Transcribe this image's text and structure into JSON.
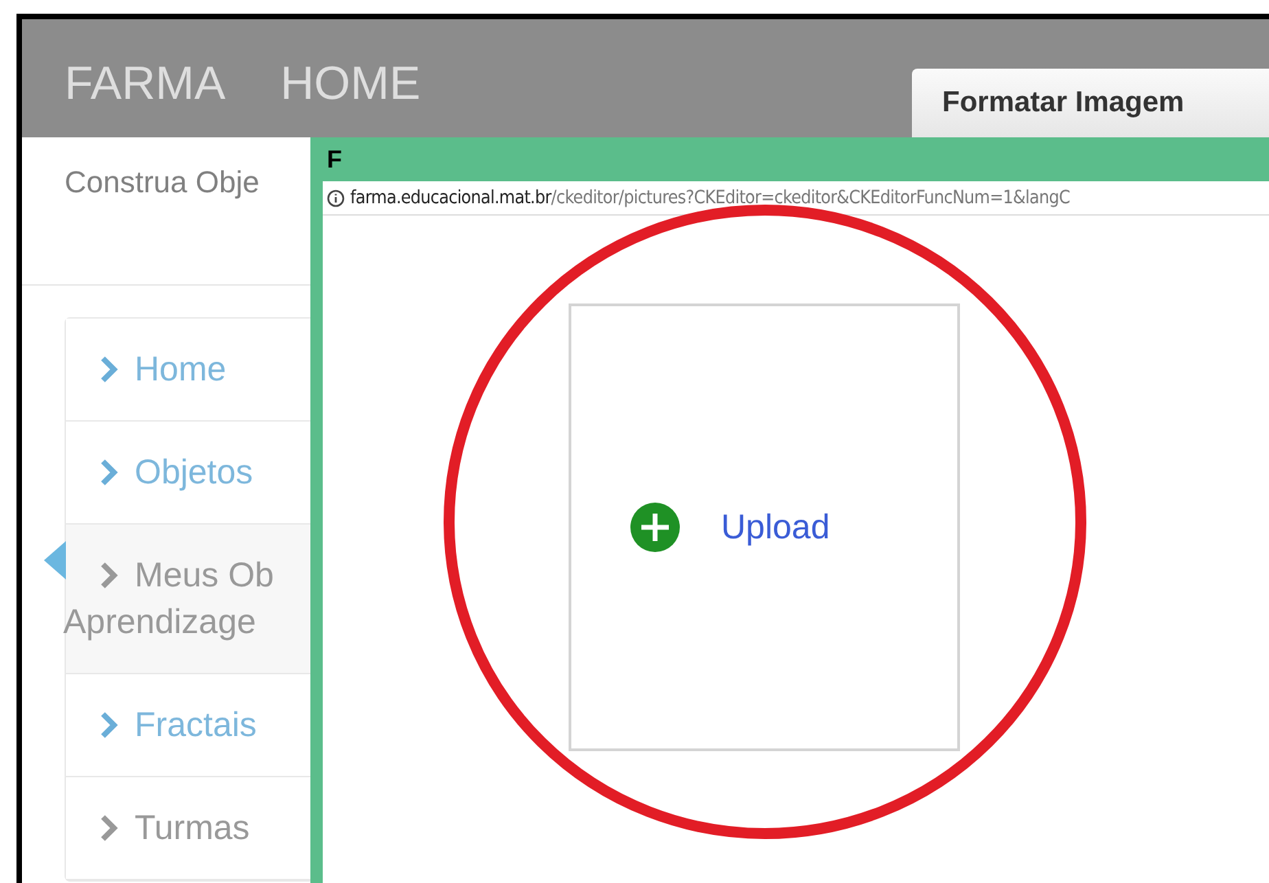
{
  "header": {
    "brand": "FARMA",
    "nav": "HOME",
    "tab": "Formatar Imagem"
  },
  "subtitle": "Construa Obje",
  "menu": [
    {
      "lines": [
        "Home"
      ],
      "selected": false,
      "muted": false
    },
    {
      "lines": [
        "Objetos"
      ],
      "selected": false,
      "muted": false
    },
    {
      "lines": [
        "Meus Ob",
        "Aprendizage"
      ],
      "selected": true,
      "muted": true
    },
    {
      "lines": [
        "Fractais"
      ],
      "selected": false,
      "muted": false
    },
    {
      "lines": [
        "Turmas"
      ],
      "selected": false,
      "muted": true
    }
  ],
  "popup": {
    "title": "F",
    "url_host": "farma.educacional.mat.br",
    "url_path": "/ckeditor/pictures?CKEditor=ckeditor&CKEditorFuncNum=1&langC",
    "upload": "Upload"
  }
}
